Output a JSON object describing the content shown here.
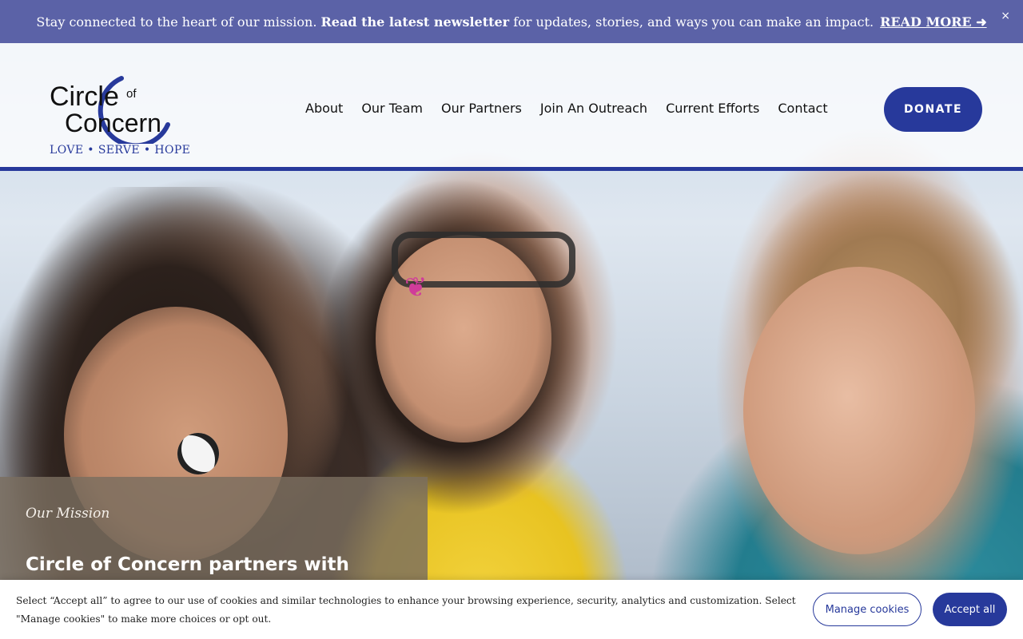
{
  "announcement": {
    "text_before": "Stay connected to the heart of our mission.",
    "text_bold": "Read the latest newsletter",
    "text_after": "for updates, stories, and ways you can make an impact.",
    "link_label": "READ MORE ➜",
    "close_label": "×"
  },
  "logo": {
    "line1": "Circle",
    "line1_small": "of",
    "line2": "Concern",
    "tagline": "LOVE • SERVE • HOPE"
  },
  "nav": {
    "items": [
      {
        "label": "About"
      },
      {
        "label": "Our Team"
      },
      {
        "label": "Our Partners"
      },
      {
        "label": "Join An Outreach"
      },
      {
        "label": "Current Efforts"
      },
      {
        "label": "Contact"
      }
    ],
    "donate_label": "DONATE"
  },
  "mission": {
    "eyebrow": "Our Mission",
    "headline": "Circle of Concern partners with"
  },
  "cookie": {
    "message": "Select “Accept all” to agree to our use of cookies and similar technologies to enhance your browsing experience, security, analytics and customization. Select \"Manage cookies\" to make more choices or opt out.",
    "manage_label": "Manage cookies",
    "accept_label": "Accept all"
  },
  "colors": {
    "brand": "#27399b",
    "announcement_bg": "#5b62a7",
    "mission_bg": "#7a6e5f"
  }
}
